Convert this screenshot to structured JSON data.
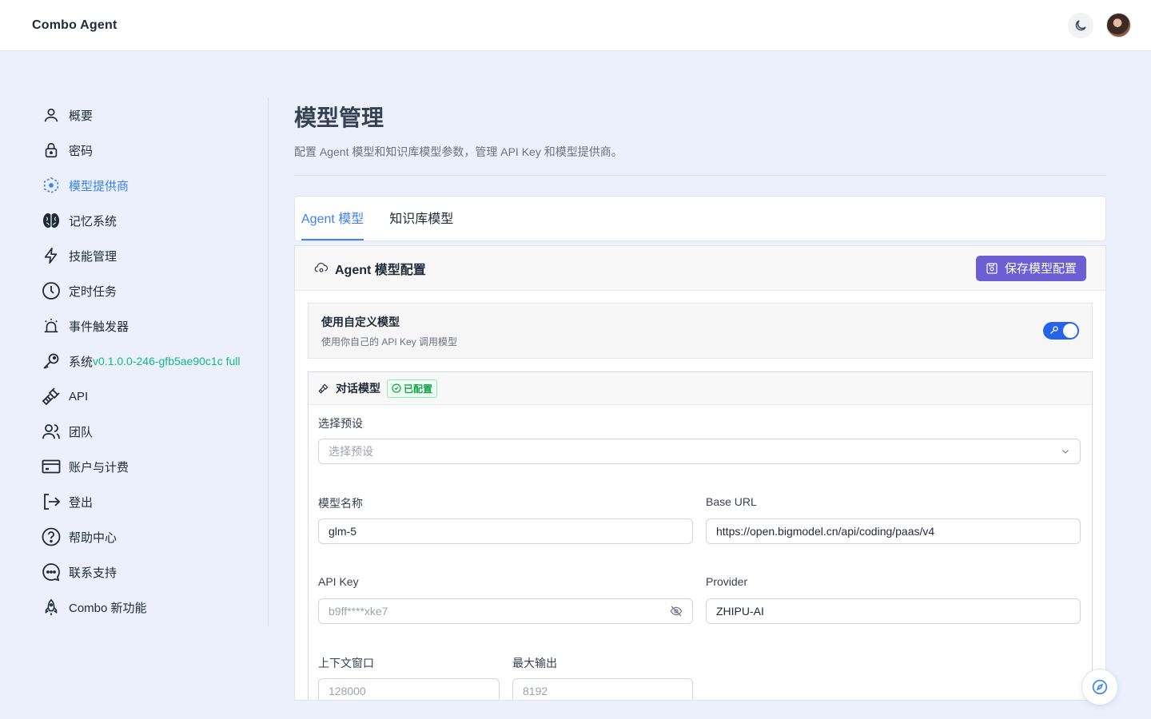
{
  "app": {
    "title": "Combo Agent"
  },
  "sidebar": {
    "items": [
      {
        "label": "概要",
        "icon": "user-icon"
      },
      {
        "label": "密码",
        "icon": "lock-icon"
      },
      {
        "label": "模型提供商",
        "icon": "model-provider-icon",
        "active": true
      },
      {
        "label": "记忆系统",
        "icon": "brain-icon"
      },
      {
        "label": "技能管理",
        "icon": "lightning-icon"
      },
      {
        "label": "定时任务",
        "icon": "clock-icon"
      },
      {
        "label": "事件触发器",
        "icon": "alarm-icon"
      },
      {
        "label": "系统",
        "icon": "key-icon",
        "version": "v0.1.0.0-246-gfb5ae90c1c full"
      },
      {
        "label": "API",
        "icon": "plug-icon"
      },
      {
        "label": "团队",
        "icon": "team-icon"
      },
      {
        "label": "账户与计费",
        "icon": "credit-card-icon"
      },
      {
        "label": "登出",
        "icon": "logout-icon"
      },
      {
        "label": "帮助中心",
        "icon": "help-icon"
      },
      {
        "label": "联系支持",
        "icon": "chat-icon"
      },
      {
        "label": "Combo 新功能",
        "icon": "rocket-icon"
      }
    ]
  },
  "main": {
    "title": "模型管理",
    "description": "配置 Agent 模型和知识库模型参数，管理 API Key 和模型提供商。",
    "tabs": [
      {
        "label": "Agent 模型",
        "active": true
      },
      {
        "label": "知识库模型",
        "active": false
      }
    ]
  },
  "config": {
    "title": "Agent 模型配置",
    "save_label": "保存模型配置",
    "custom_model": {
      "title": "使用自定义模型",
      "subtitle": "使用你自己的 API Key 调用模型",
      "enabled": true
    },
    "chat_model": {
      "title": "对话模型",
      "status": "已配置",
      "preset_label": "选择预设",
      "preset_placeholder": "选择预设",
      "model_name_label": "模型名称",
      "model_name_value": "glm-5",
      "base_url_label": "Base URL",
      "base_url_value": "https://open.bigmodel.cn/api/coding/paas/v4",
      "api_key_label": "API Key",
      "api_key_value": "b9ff****xke7",
      "provider_label": "Provider",
      "provider_value": "ZHIPU-AI",
      "context_label": "上下文窗口",
      "context_placeholder": "128000",
      "max_output_label": "最大输出",
      "max_output_placeholder": "8192"
    }
  },
  "colors": {
    "accent": "#3b82f6",
    "save_button": "#6d5fd3",
    "version_text": "#10b981",
    "page_bg": "#ebf0fc"
  }
}
